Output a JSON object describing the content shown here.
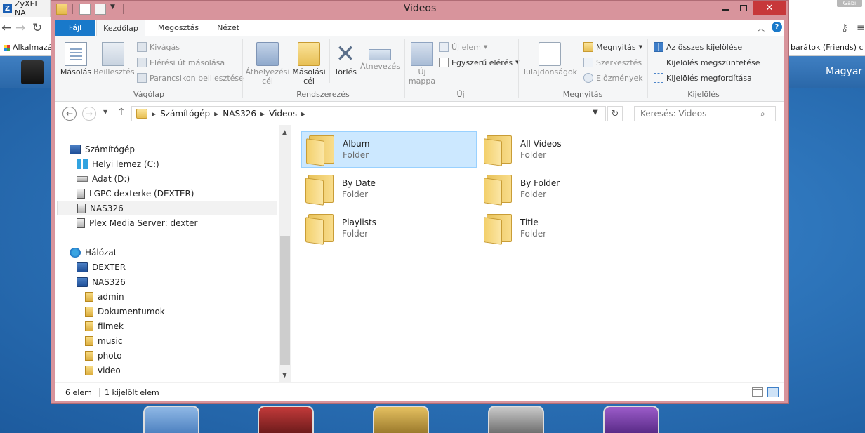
{
  "background": {
    "tab_title": "ZyXEL NA",
    "bookmark_apps": "Alkalmazás",
    "bookmark_right": "barátok (Friends) c",
    "banner_lang": "Magyar",
    "user_badge": "Gabi"
  },
  "window": {
    "title": "Videos"
  },
  "ribbon_tabs": {
    "file": "Fájl",
    "home": "Kezdőlap",
    "share": "Megosztás",
    "view": "Nézet"
  },
  "ribbon": {
    "clipboard": {
      "label": "Vágólap",
      "copy": "Másolás",
      "paste": "Beillesztés",
      "cut": "Kivágás",
      "copy_path": "Elérési út másolása",
      "paste_shortcut": "Parancsikon beillesztése"
    },
    "organize": {
      "label": "Rendszerezés",
      "move_to_1": "Áthelyezési",
      "move_to_2": "cél",
      "copy_to_1": "Másolási",
      "copy_to_2": "cél",
      "delete": "Törlés",
      "rename": "Átnevezés"
    },
    "new": {
      "label": "Új",
      "new_folder_1": "Új",
      "new_folder_2": "mappa",
      "new_item": "Új elem",
      "easy_access": "Egyszerű elérés"
    },
    "open": {
      "label": "Megnyitás",
      "properties": "Tulajdonságok",
      "open": "Megnyitás",
      "edit": "Szerkesztés",
      "history": "Előzmények"
    },
    "select": {
      "label": "Kijelölés",
      "select_all": "Az összes kijelölése",
      "select_none": "Kijelölés megszüntetése",
      "invert": "Kijelölés megfordítása"
    }
  },
  "address": {
    "crumbs": [
      "Számítógép",
      "NAS326",
      "Videos"
    ],
    "search_placeholder": "Keresés: Videos"
  },
  "nav_tree": {
    "computer": "Számítógép",
    "drive_c": "Helyi lemez (C:)",
    "drive_d": "Adat (D:)",
    "lgpc": "LGPC dexterke (DEXTER)",
    "nas": "NAS326",
    "plex": "Plex Media Server: dexter",
    "network": "Hálózat",
    "dexter": "DEXTER",
    "nas_net": "NAS326",
    "shares": [
      "admin",
      "Dokumentumok",
      "filmek",
      "music",
      "photo",
      "video"
    ]
  },
  "folders": [
    {
      "name": "Album",
      "type": "Folder"
    },
    {
      "name": "All Videos",
      "type": "Folder"
    },
    {
      "name": "By Date",
      "type": "Folder"
    },
    {
      "name": "By Folder",
      "type": "Folder"
    },
    {
      "name": "Playlists",
      "type": "Folder"
    },
    {
      "name": "Title",
      "type": "Folder"
    }
  ],
  "status": {
    "count": "6 elem",
    "selected": "1 kijelölt elem"
  },
  "colors": {
    "title_bar": "#d8949c",
    "file_tab": "#1979ca",
    "selection": "#cce8ff",
    "close_button": "#c7373a"
  }
}
